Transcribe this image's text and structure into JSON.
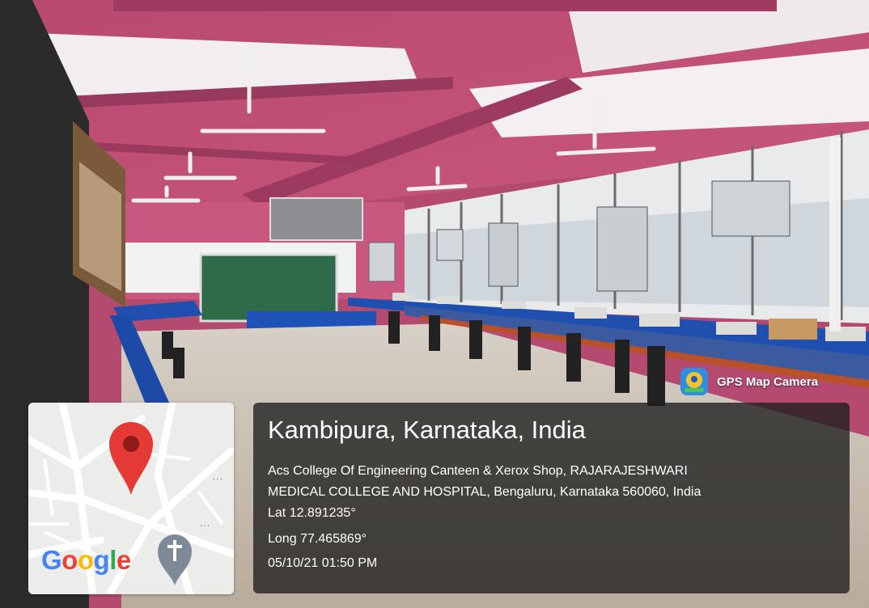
{
  "badge": {
    "label": "GPS Map Camera",
    "icon": "map-pin-camera-icon"
  },
  "map": {
    "logo": "Google",
    "icons": [
      "red-location-pin-icon",
      "church-cross-pin-icon"
    ],
    "dots": "...",
    "colors": {
      "pin": "#E53935",
      "road": "#ffffff",
      "land": "#ececea"
    }
  },
  "info": {
    "location": "Kambipura, Karnataka, India",
    "address_line1": "Acs College Of Engineering Canteen & Xerox Shop, RAJARAJESHWARI",
    "address_line2": "MEDICAL COLLEGE AND HOSPITAL, Bengaluru, Karnataka 560060, India",
    "lat": "Lat 12.891235°",
    "long": "Long 77.465869°",
    "datetime": "05/10/21 01:50 PM"
  }
}
